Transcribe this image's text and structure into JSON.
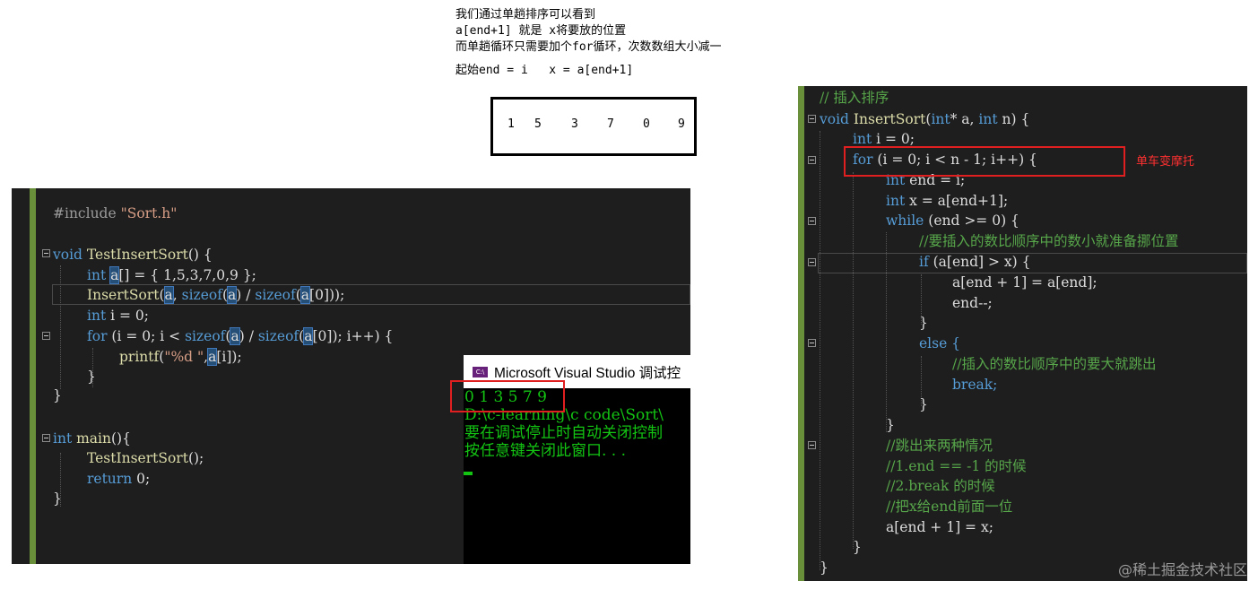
{
  "notes": {
    "line1": "我们通过单趟排序可以看到",
    "line2": "a[end+1] 就是 x将要放的位置",
    "line3": "而单趟循环只需要加个for循环，次数数组大小减一",
    "line4": "起始end = i   x = a[end+1]"
  },
  "array_box": [
    "1",
    "5",
    "3",
    "7",
    "0",
    "9"
  ],
  "left_editor": {
    "lines": [
      {
        "text": "#include \"Sort.h\""
      },
      {
        "text": "void TestInsertSort() {"
      },
      {
        "text": "int a[] = { 1,5,3,7,0,9 };"
      },
      {
        "text": "InsertSort(a, sizeof(a) / sizeof(a[0]));"
      },
      {
        "text": "int i = 0;"
      },
      {
        "text": "for (i = 0; i < sizeof(a) / sizeof(a[0]); i++) {"
      },
      {
        "text": "printf(\"%d \",a[i]);"
      },
      {
        "text": "}"
      },
      {
        "text": "}"
      },
      {
        "text": "int main(){"
      },
      {
        "text": "TestInsertSort();"
      },
      {
        "text": "return 0;"
      },
      {
        "text": "}"
      }
    ]
  },
  "console": {
    "title": "Microsoft Visual Studio 调试控",
    "icon": "vs-console-icon",
    "output": [
      "0 1 3 5 7 9",
      "D:\\c-learning\\c code\\Sort\\",
      "要在调试停止时自动关闭控制",
      "按任意键关闭此窗口. . ."
    ]
  },
  "right_editor": {
    "lines": [
      "// 插入排序",
      "void InsertSort(int* a, int n) {",
      "int i = 0;",
      "for (i = 0; i < n - 1; i++) {",
      "int end = i;",
      "int x = a[end+1];",
      "while (end >= 0) {",
      "//要插入的数比顺序中的数小就准备挪位置",
      "if (a[end] > x) {",
      "a[end + 1] = a[end];",
      "end--;",
      "}",
      "else {",
      "//插入的数比顺序中的要大就跳出",
      "break;",
      "}",
      "}",
      "//跳出来两种情况",
      "//1.end == -1 的时候",
      "//2.break 的时候",
      "//把x给end前面一位",
      "a[end + 1] = x;",
      "}",
      "}"
    ]
  },
  "annotation": "单车变摩托",
  "watermark": "@稀土掘金技术社区",
  "colors": {
    "red_box": "#e02020",
    "console_text": "#13c413",
    "keyword": "#569cd6",
    "comment": "#57a64a"
  }
}
